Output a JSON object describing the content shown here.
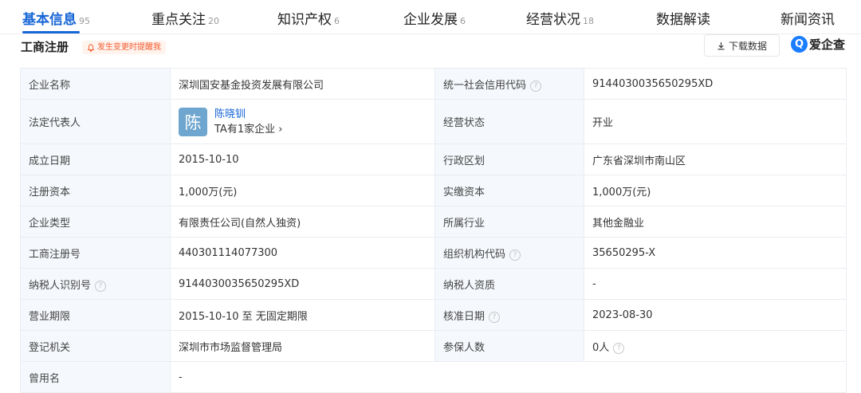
{
  "tabs": [
    {
      "label": "基本信息",
      "count": "95"
    },
    {
      "label": "重点关注",
      "count": "20"
    },
    {
      "label": "知识产权",
      "count": "6"
    },
    {
      "label": "企业发展",
      "count": "6"
    },
    {
      "label": "经营状况",
      "count": "18"
    },
    {
      "label": "数据解读",
      "count": ""
    },
    {
      "label": "新闻资讯",
      "count": ""
    }
  ],
  "section": {
    "title": "工商注册",
    "alert": "发生变更时提醒我",
    "download": "下载数据",
    "brand": "爱企查",
    "brand_letter": "Q"
  },
  "colors": {
    "accent": "#1766d6",
    "alert": "#f25b2c",
    "label_bg": "#f5f8fc"
  },
  "rows": [
    {
      "l1": "企业名称",
      "v1": "深圳国安基金投资发展有限公司",
      "l2": "统一社会信用代码",
      "v2": "9144030035650295XD"
    },
    {
      "l1": "法定代表人",
      "person_avatar": "陈",
      "person_name": "陈晓钏",
      "person_sub": "TA有1家企业 ›",
      "l2": "经营状态",
      "v2": "开业"
    },
    {
      "l1": "成立日期",
      "v1": "2015-10-10",
      "l2": "行政区划",
      "v2": "广东省深圳市南山区"
    },
    {
      "l1": "注册资本",
      "v1": "1,000万(元)",
      "l2": "实缴资本",
      "v2": "1,000万(元)"
    },
    {
      "l1": "企业类型",
      "v1": "有限责任公司(自然人独资)",
      "l2": "所属行业",
      "v2": "其他金融业"
    },
    {
      "l1": "工商注册号",
      "v1": "440301114077300",
      "l2": "组织机构代码",
      "v2": "35650295-X"
    },
    {
      "l1": "纳税人识别号",
      "v1": "9144030035650295XD",
      "l2": "纳税人资质",
      "v2": "-"
    },
    {
      "l1": "营业期限",
      "v1": "2015-10-10 至 无固定期限",
      "l2": "核准日期",
      "v2": "2023-08-30"
    },
    {
      "l1": "登记机关",
      "v1": "深圳市市场监督管理局",
      "l2": "参保人数",
      "v2": "0人"
    },
    {
      "l1": "曾用名",
      "v1": "-"
    }
  ]
}
